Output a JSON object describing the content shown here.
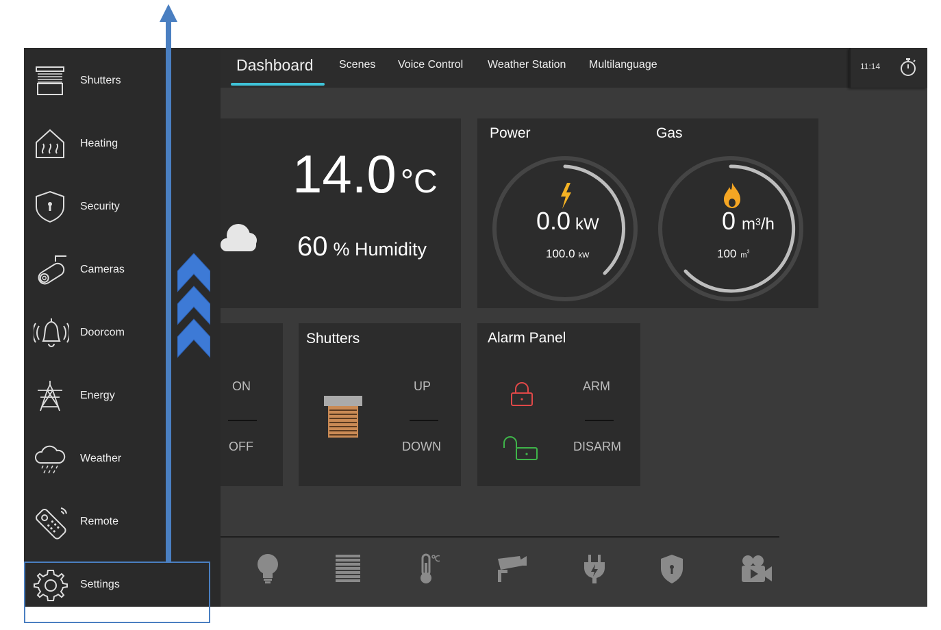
{
  "sidebar": {
    "items": [
      {
        "label": "Shutters",
        "icon": "shutters-icon"
      },
      {
        "label": "Heating",
        "icon": "heating-icon"
      },
      {
        "label": "Security",
        "icon": "security-icon"
      },
      {
        "label": "Cameras",
        "icon": "camera-icon"
      },
      {
        "label": "Doorcom",
        "icon": "doorbell-icon"
      },
      {
        "label": "Energy",
        "icon": "energy-icon"
      },
      {
        "label": "Weather",
        "icon": "weather-icon"
      },
      {
        "label": "Remote",
        "icon": "remote-icon"
      },
      {
        "label": "Settings",
        "icon": "gear-icon"
      }
    ]
  },
  "tabs": [
    {
      "label": "Dashboard",
      "active": true
    },
    {
      "label": "Scenes"
    },
    {
      "label": "Voice Control"
    },
    {
      "label": "Weather Station"
    },
    {
      "label": "Multilanguage"
    }
  ],
  "clock": "11:14",
  "weather": {
    "temperature": "14.0",
    "temperature_unit": "°C",
    "humidity": "60",
    "humidity_label": "% Humidity"
  },
  "power": {
    "title": "Power",
    "value": "0.0",
    "unit": "kW",
    "max": "100.0",
    "max_unit": "kW"
  },
  "gas": {
    "title": "Gas",
    "value": "0",
    "unit": "m",
    "unit_sup": "3",
    "unit_suffix": "/h",
    "max": "100",
    "max_unit": "m",
    "max_unit_sup": "3"
  },
  "lights_card": {
    "on": "ON",
    "off": "OFF"
  },
  "shutters_card": {
    "title": "Shutters",
    "up": "UP",
    "down": "DOWN"
  },
  "alarm_card": {
    "title": "Alarm Panel",
    "arm": "ARM",
    "disarm": "DISARM"
  },
  "bottom_bar": {
    "icons": [
      "bulb-icon",
      "shutters-icon",
      "thermometer-icon",
      "camera-icon",
      "plug-icon",
      "shield-icon",
      "video-icon"
    ]
  },
  "colors": {
    "accent": "#3fc3d8",
    "power_bolt": "#f5b324",
    "gas_flame": "#f5a623",
    "lock_red": "#e04848",
    "unlock_green": "#3fb54a",
    "annotation_blue": "#4a7fc1"
  }
}
